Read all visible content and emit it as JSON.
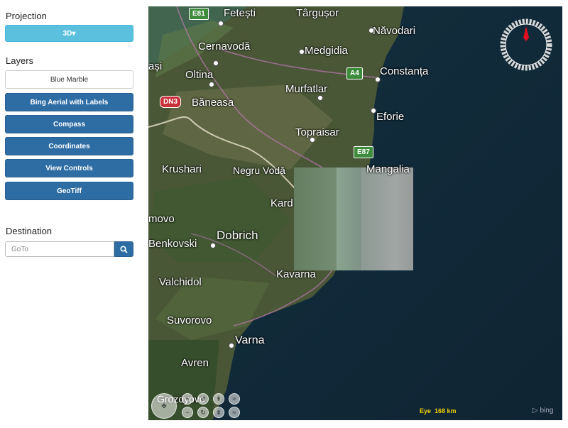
{
  "sidebar": {
    "projection_heading": "Projection",
    "projection_button": "3D▾",
    "layers_heading": "Layers",
    "layers": [
      {
        "label": "Blue Marble",
        "active": false
      },
      {
        "label": "Bing Aerial with Labels",
        "active": true
      },
      {
        "label": "Compass",
        "active": true
      },
      {
        "label": "Coordinates",
        "active": true
      },
      {
        "label": "View Controls",
        "active": true
      },
      {
        "label": "GeoTiff",
        "active": true
      }
    ],
    "destination_heading": "Destination",
    "goto_placeholder": "GoTo",
    "search_icon": "search-icon"
  },
  "map": {
    "places": {
      "fetesti": "Fetești",
      "targusor": "Târgușor",
      "navodari": "Năvodari",
      "cernavoda": "Cernavodă",
      "medgidia": "Medgidia",
      "constanta": "Constanța",
      "rasi": "ași",
      "oltina": "Oltina",
      "murfatlar": "Murfatlar",
      "baneasa": "Băneasa",
      "eforie": "Eforie",
      "topraisar": "Topraisar",
      "krushari": "Krushari",
      "negru_voda": "Negru Vodă",
      "mangalia": "Mangalia",
      "kard": "Kard",
      "ovo": "movo",
      "dobrich": "Dobrich",
      "benkovski": "Benkovski",
      "kavarna": "Kavarna",
      "valchidol": "Valchidol",
      "suvorovo": "Suvorovo",
      "varna": "Varna",
      "avren": "Avren",
      "grozdyovo": "Grozdyovo"
    },
    "roads": {
      "e81": "E81",
      "a4": "A4",
      "dn3": "DN3",
      "e87": "E87"
    },
    "eye_label": "Eye",
    "eye_value": "168 km",
    "attribution": "bing",
    "colors": {
      "sea": "#122b3b",
      "land": "#4d5a3a",
      "compass_needle": "#e01020",
      "eye_text": "#f0d000"
    }
  }
}
